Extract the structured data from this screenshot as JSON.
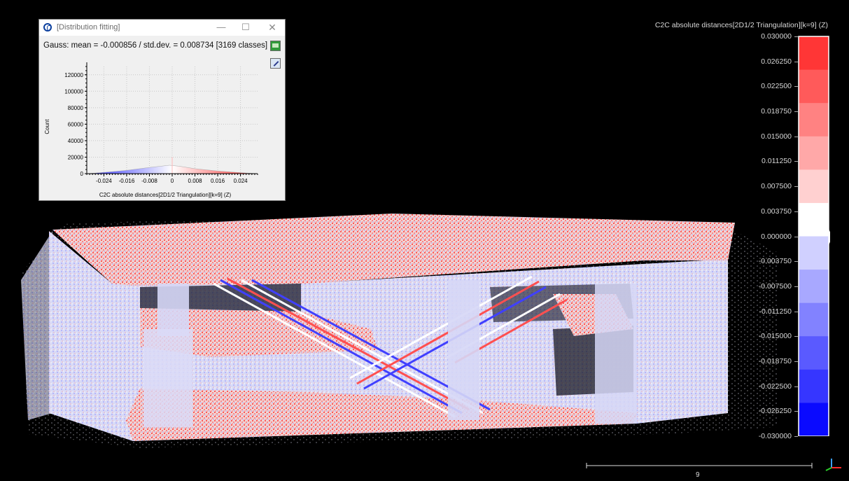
{
  "dialog": {
    "title": "[Distribution fitting]",
    "minimize_glyph": "—",
    "maximize_glyph": "☐",
    "close_glyph": "✕",
    "fit_text": "Gauss: mean = -0.000856 / std.dev. = 0.008734 [3169 classes]",
    "export_icon": "export-csv-icon",
    "settings_icon": "wrench-icon"
  },
  "chart_data": {
    "type": "area",
    "title": "",
    "xlabel": "C2C absolute distances[2D1/2 Triangulation][k=9] (Z)",
    "ylabel": "Count",
    "x_ticks": [
      "-0.024",
      "-0.016",
      "-0.008",
      "0",
      "0.008",
      "0.016",
      "0.024"
    ],
    "y_ticks": [
      "0",
      "20000",
      "40000",
      "60000",
      "80000",
      "100000",
      "120000"
    ],
    "xlim": [
      -0.03,
      0.03
    ],
    "ylim": [
      0,
      130000
    ],
    "grid": true,
    "color_low": "#2020ff",
    "color_mid": "#ffffff",
    "color_high": "#ff2020",
    "x": [
      -0.03,
      -0.024,
      -0.016,
      -0.008,
      -0.004,
      -0.002,
      -0.0009,
      0,
      0.002,
      0.004,
      0.008,
      0.016,
      0.024,
      0.03
    ],
    "y": [
      0,
      1500,
      4000,
      7500,
      9000,
      9800,
      10200,
      9800,
      9200,
      8200,
      6000,
      3200,
      1200,
      0
    ]
  },
  "scalar_field": {
    "title": "C2C absolute distances[2D1/2 Triangulation][k=9] (Z)",
    "labels": [
      "0.030000",
      "0.026250",
      "0.022500",
      "0.018750",
      "0.015000",
      "0.011250",
      "0.007500",
      "0.003750",
      "0.000000",
      "-0.003750",
      "-0.007500",
      "-0.011250",
      "-0.015000",
      "-0.018750",
      "-0.022500",
      "-0.026250",
      "-0.030000"
    ],
    "band_colors": [
      "#ff3636",
      "#ff5a5a",
      "#ff8282",
      "#ffa8a8",
      "#ffd0d0",
      "#ffffff",
      "#d0d0ff",
      "#a8a8ff",
      "#8282ff",
      "#5a5aff",
      "#3636ff",
      "#0a0aff"
    ]
  },
  "viewport": {
    "scale_value": "9",
    "axis_icon": "axis-triad-icon"
  }
}
